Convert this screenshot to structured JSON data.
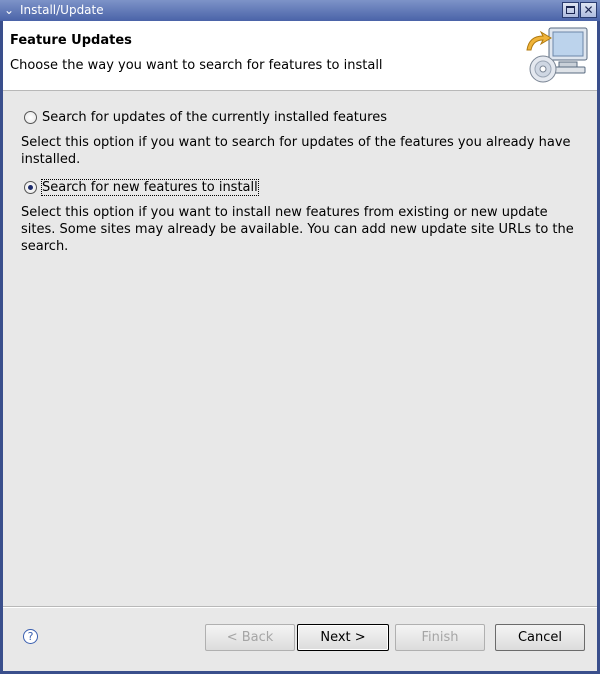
{
  "window": {
    "title": "Install/Update",
    "menu_icon": "chevron-down-icon",
    "maximize_icon": "maximize-icon",
    "close_icon": "close-icon"
  },
  "header": {
    "title": "Feature Updates",
    "description": "Choose the way you want to search for features to install",
    "icon": "install-update-wizard-icon"
  },
  "options": [
    {
      "label": "Search for updates of the currently installed features",
      "description": "Select this option if you want to search for updates of the features you already have installed.",
      "selected": false
    },
    {
      "label": "Search for new features to install",
      "description": "Select this option if you want to install new features from existing or new update sites. Some sites may already be available. You can add new update site URLs to the search.",
      "selected": true
    }
  ],
  "footer": {
    "help_icon": "help-icon",
    "back_label": "< Back",
    "next_label": "Next >",
    "finish_label": "Finish",
    "cancel_label": "Cancel"
  },
  "colors": {
    "titlebar": "#4a63a8",
    "dialog_bg": "#e8e8e8",
    "header_bg": "#ffffff"
  }
}
